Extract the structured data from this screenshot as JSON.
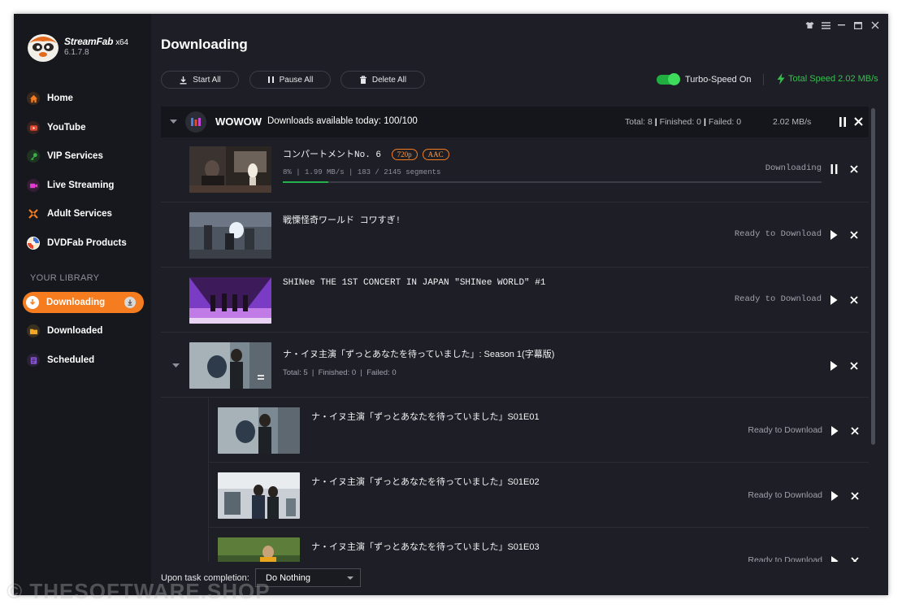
{
  "app": {
    "brand": "StreamFab",
    "arch": "x64",
    "version": "6.1.7.8",
    "page_title": "Downloading"
  },
  "sidebar": {
    "items": [
      {
        "label": "Home",
        "icon": "home-icon",
        "color": "#f57c1f"
      },
      {
        "label": "YouTube",
        "icon": "youtube-icon",
        "color": "#e5462d"
      },
      {
        "label": "VIP Services",
        "icon": "key-icon",
        "color": "#38b24a"
      },
      {
        "label": "Live Streaming",
        "icon": "camera-icon",
        "color": "#e13bd1"
      },
      {
        "label": "Adult Services",
        "icon": "adult-icon",
        "color": "#f57c1f"
      },
      {
        "label": "DVDFab Products",
        "icon": "dvdfab-icon",
        "color": "#3b6fd8"
      }
    ],
    "library_title": "YOUR LIBRARY",
    "library": [
      {
        "label": "Downloading",
        "icon": "download-icon",
        "active": true
      },
      {
        "label": "Downloaded",
        "icon": "folder-icon",
        "color": "#f5a623"
      },
      {
        "label": "Scheduled",
        "icon": "schedule-icon",
        "color": "#8a57d8"
      }
    ]
  },
  "toolbar": {
    "start_all": "Start All",
    "pause_all": "Pause All",
    "delete_all": "Delete All",
    "turbo_label": "Turbo-Speed On",
    "total_speed": "Total Speed 2.02 MB/s"
  },
  "group": {
    "service": "WOWOW",
    "available": "Downloads available today: 100/100",
    "total": "Total: 8",
    "finished": "Finished: 0",
    "failed": "Failed: 0",
    "speed": "2.02 MB/s"
  },
  "rows": [
    {
      "title": "コンパートメントNo. 6",
      "tags": [
        "720p",
        "AAC"
      ],
      "progress": "8%",
      "rate": "1.99 MB/s",
      "segments": "183 / 2145 segments",
      "fraction": 0.085,
      "status": "Downloading"
    },
    {
      "title": "戦慄怪奇ワールド コワすぎ!",
      "status": "Ready to Download"
    },
    {
      "title": "SHINee THE 1ST CONCERT IN JAPAN \"SHINee WORLD\" #1",
      "status": "Ready to Download"
    },
    {
      "title": "ナ・イヌ主演「ずっとあなたを待っていました」: Season 1(字幕版)",
      "total": "Total: 5",
      "finished": "Finished: 0",
      "failed": "Failed: 0"
    },
    {
      "title": "ナ・イヌ主演「ずっとあなたを待っていました」S01E01",
      "status": "Ready to Download"
    },
    {
      "title": "ナ・イヌ主演「ずっとあなたを待っていました」S01E02",
      "status": "Ready to Download"
    },
    {
      "title": "ナ・イヌ主演「ずっとあなたを待っていました」S01E03",
      "status": "Ready to Download"
    }
  ],
  "footer": {
    "label": "Upon task completion:",
    "select_value": "Do Nothing"
  },
  "watermark": "© THESOFTWARE.SHOP"
}
